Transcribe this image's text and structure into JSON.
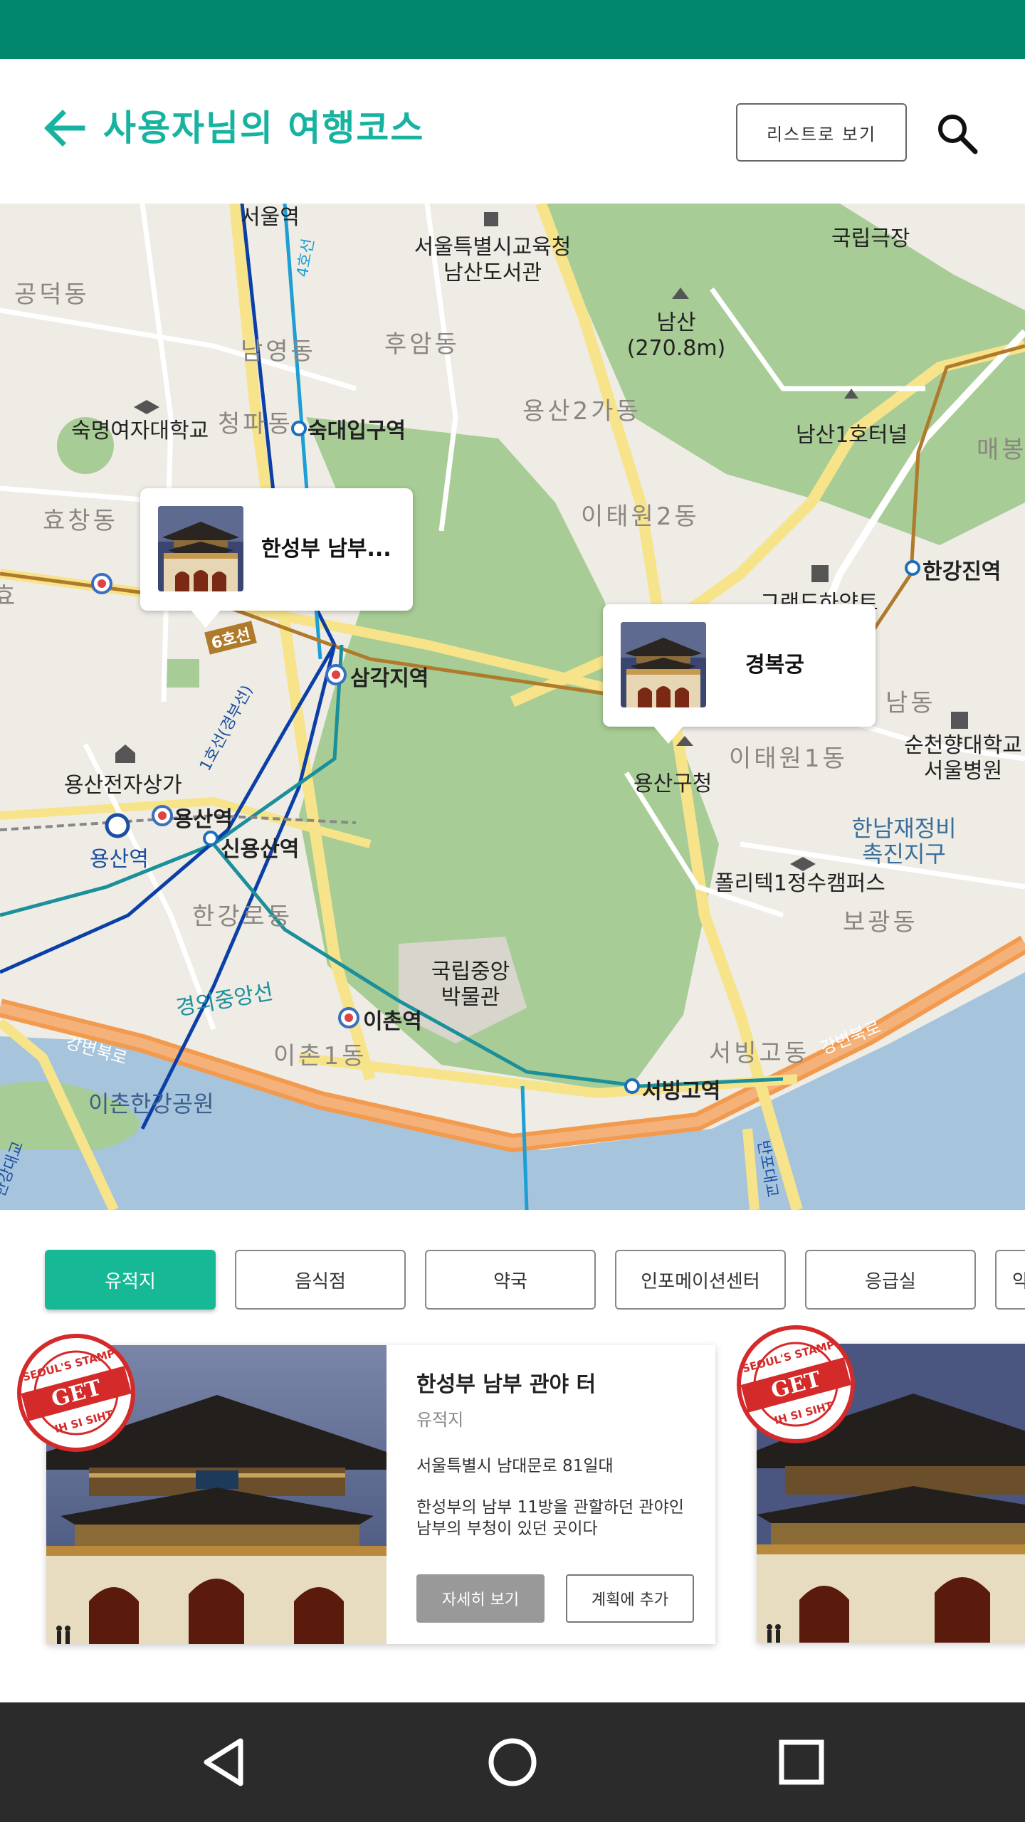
{
  "header": {
    "title": "사용자님의 여행코스",
    "list_view_label": "리스트로 보기",
    "back_icon": "arrow-left-icon",
    "search_icon": "search-icon"
  },
  "colors": {
    "status_bar": "#00876d",
    "accent": "#17b3a0",
    "chip_active": "#17b896",
    "nav_bar": "#2b2b2b"
  },
  "map": {
    "labels": {
      "seoul_station": "서울역",
      "education_office": "서울특별시교육청\n남산도서관",
      "national_theater": "국립극장",
      "namsan": "남산\n(270.8m)",
      "gongdeok": "공덕동",
      "namyeong": "남영동",
      "huam": "후암동",
      "sookmyung": "숙명여자대학교",
      "cheongpa": "청파동",
      "sookdae_station": "숙대입구역",
      "yongsan2ga": "용산2가동",
      "namsan_tunnel": "남산1호터널",
      "maebong": "매봉",
      "hyochang": "효창동",
      "itaewon2": "이태원2동",
      "grand_hyatt": "그랜드하얏트",
      "hangangjin": "한강진역",
      "samgakji": "삼각지역",
      "yongsan_gu": "용산구청",
      "itaewon1": "이태원1동",
      "namdong": "남동",
      "soonchunhyang": "순천향대학교\n서울병원",
      "yongsan_electronics": "용산전자상가",
      "yongsan_station_1": "용산역",
      "yongsan_station_2": "용산역",
      "sinyongsan": "신용산역",
      "hannam": "한남재정비\n촉진지구",
      "polytech": "폴리텍1정수캠퍼스",
      "bogwang": "보광동",
      "hangangro": "한강로동",
      "museum": "국립중앙\n박물관",
      "ichon_station": "이촌역",
      "gyeongui_line": "경의중앙선",
      "ichon1": "이촌1동",
      "seobinggo_dong": "서빙고동",
      "gangbyeon1": "강변북로",
      "gangbyeon2": "강변북로",
      "seobinggo_station": "서빙고역",
      "ichon_park": "이촌한강공원",
      "line4": "4호선",
      "line6": "6호선",
      "line1": "1호선(경부선)",
      "banpo": "반포대교",
      "hangang_bridge": "한강대교",
      "gongdeok_station": "효"
    },
    "popups": [
      {
        "label": "한성부 남부...",
        "thumb_icon": "palace-thumbnail"
      },
      {
        "label": "경복궁",
        "thumb_icon": "palace-thumbnail"
      }
    ]
  },
  "chips": [
    {
      "label": "유적지",
      "active": true
    },
    {
      "label": "음식점",
      "active": false
    },
    {
      "label": "약국",
      "active": false
    },
    {
      "label": "인포메이션센터",
      "active": false
    },
    {
      "label": "응급실",
      "active": false
    },
    {
      "label": "약",
      "active": false
    }
  ],
  "card": {
    "title": "한성부 남부 관야 터",
    "category": "유적지",
    "address": "서울특별시 남대문로 81일대",
    "description": "한성부의 남부 11방을 관할하던 관야인 남부의 부청이 있던 곳이다",
    "detail_label": "자세히 보기",
    "add_label": "계획에 추가",
    "stamp": {
      "top_text": "SEOUL'S STAMP",
      "middle_text": "GET",
      "bottom_text": "IH SI SIHT"
    }
  },
  "nav": {
    "back_icon": "nav-back-icon",
    "home_icon": "nav-home-icon",
    "recents_icon": "nav-recents-icon"
  }
}
